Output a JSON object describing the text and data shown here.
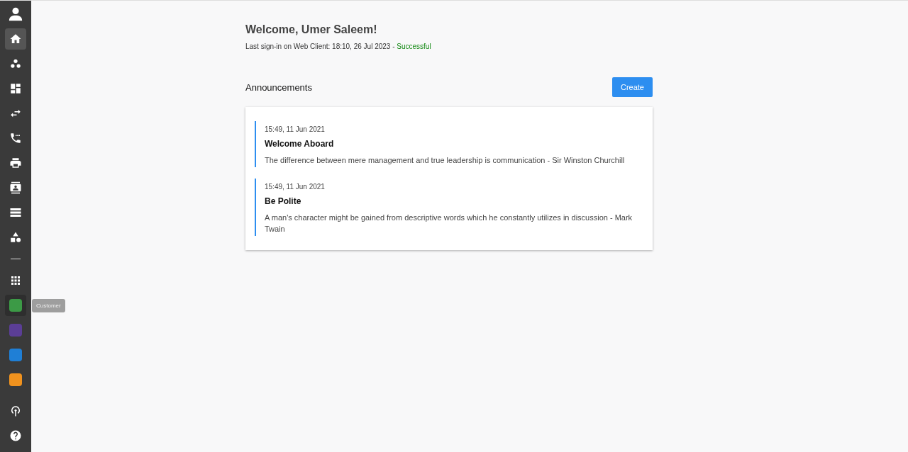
{
  "sidebar": {
    "nav": [
      {
        "kind": "home",
        "selected": true
      },
      {
        "kind": "groups",
        "selected": false
      },
      {
        "kind": "dashboard",
        "selected": false
      },
      {
        "kind": "transfer",
        "selected": false
      },
      {
        "kind": "calls",
        "selected": false
      },
      {
        "kind": "print",
        "selected": false
      },
      {
        "kind": "contact",
        "selected": false
      },
      {
        "kind": "list",
        "selected": false
      },
      {
        "kind": "shapes",
        "selected": false
      }
    ],
    "apps": [
      {
        "color": "#3c9a46",
        "hovered": true
      },
      {
        "color": "#5b3e96",
        "hovered": false
      },
      {
        "color": "#1f7fd6",
        "hovered": false
      },
      {
        "color": "#f0921e",
        "hovered": false
      }
    ],
    "tooltip": "Customer"
  },
  "welcome": {
    "title": "Welcome, Umer Saleem!",
    "last_signin": "Last sign-in on Web Client: 18:10, 26 Jul 2023 -",
    "status": "Successful"
  },
  "announcements": {
    "title": "Announcements",
    "create_button": "Create",
    "items": [
      {
        "time": "15:49, 11 Jun 2021",
        "title": "Welcome Aboard",
        "body": "The difference between mere management and true leadership is communication - Sir Winston Churchill"
      },
      {
        "time": "15:49, 11 Jun 2021",
        "title": "Be Polite",
        "body": "A man's character might be gained from descriptive words which he constantly utilizes in discussion - Mark Twain"
      }
    ]
  }
}
